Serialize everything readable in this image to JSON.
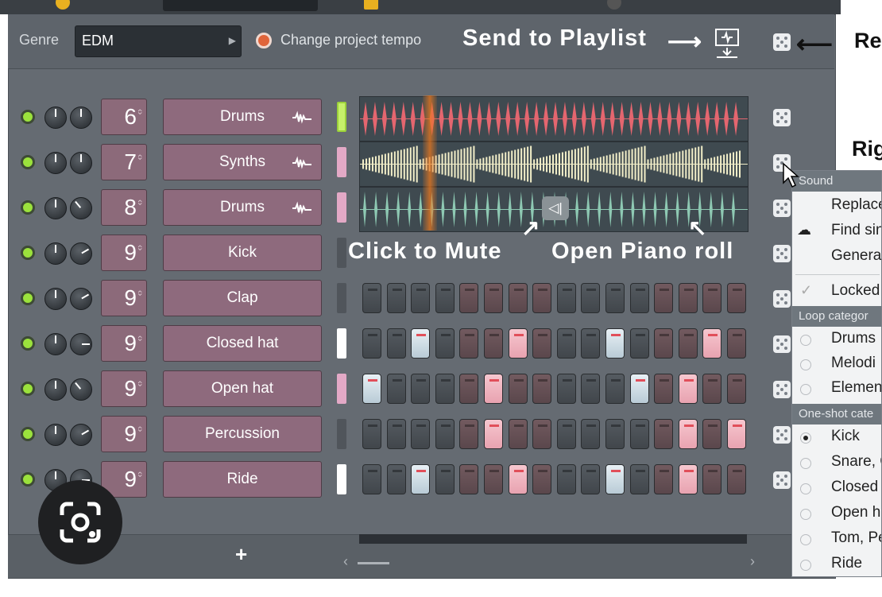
{
  "header": {
    "genre_label": "Genre",
    "genre_value": "EDM",
    "tempo_label": "Change project tempo",
    "send_label": "Send to Playlist",
    "send_arrow": "→"
  },
  "annotations": {
    "click_to_mute": "Click to Mute",
    "open_piano_roll": "Open Piano roll",
    "right_top": "Re",
    "right_mid": "Rig"
  },
  "channels": [
    {
      "num": "6",
      "name": "Drums",
      "has_wave": true
    },
    {
      "num": "7",
      "name": "Synths",
      "has_wave": true
    },
    {
      "num": "8",
      "name": "Drums",
      "has_wave": true
    },
    {
      "num": "9",
      "name": "Kick",
      "has_wave": false
    },
    {
      "num": "9",
      "name": "Clap",
      "has_wave": false
    },
    {
      "num": "9",
      "name": "Closed hat",
      "has_wave": false
    },
    {
      "num": "9",
      "name": "Open hat",
      "has_wave": false
    },
    {
      "num": "9",
      "name": "Percussion",
      "has_wave": false
    },
    {
      "num": "9",
      "name": "Ride",
      "has_wave": false
    }
  ],
  "menu": {
    "sound_header": "Sound",
    "replace": "Replace",
    "find_similar": "Find sin",
    "generate": "Genera",
    "locked": "Locked",
    "loop_header": "Loop categor",
    "loop_items": [
      "Drums",
      "Melodi",
      "Elemen"
    ],
    "oneshot_header": "One-shot cate",
    "oneshot_items": [
      "Kick",
      "Snare, C",
      "Closed",
      "Open h",
      "Tom, Pe",
      "Ride"
    ],
    "selected_oneshot": "Kick"
  },
  "bottom": {
    "add_label": "+"
  },
  "colors": {
    "rack_bg": "#656b72",
    "channel_button": "#8e6a7d",
    "led_on": "#9be23c",
    "wave_red": "#e4666f",
    "wave_cream": "#f3efc9",
    "wave_teal": "#8ec9b3",
    "playhead": "#eb781e"
  }
}
